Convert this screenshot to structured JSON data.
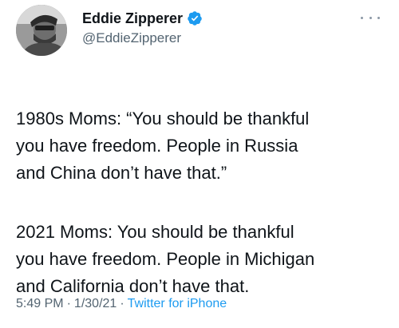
{
  "author": {
    "display_name": "Eddie Zipperer",
    "handle": "@EddieZipperer",
    "verified": true,
    "avatar_icon": "profile-photo"
  },
  "tweet": {
    "paragraphs": [
      "1980s Moms: “You should be thankful\nyou have freedom. People in Russia\nand China don’t have that.”",
      "2021 Moms: You should be thankful\nyou have freedom. People in Michigan\nand California don’t have that."
    ]
  },
  "meta": {
    "time": "5:49 PM",
    "separator": "·",
    "date": "1/30/21",
    "source": "Twitter for iPhone"
  },
  "colors": {
    "verified_blue": "#1d9bf0",
    "link_blue": "#1d9bf0",
    "secondary_text": "#536471",
    "primary_text": "#0f1419"
  },
  "icons": {
    "verified": "verified-badge-icon",
    "more": "more-options-icon"
  }
}
